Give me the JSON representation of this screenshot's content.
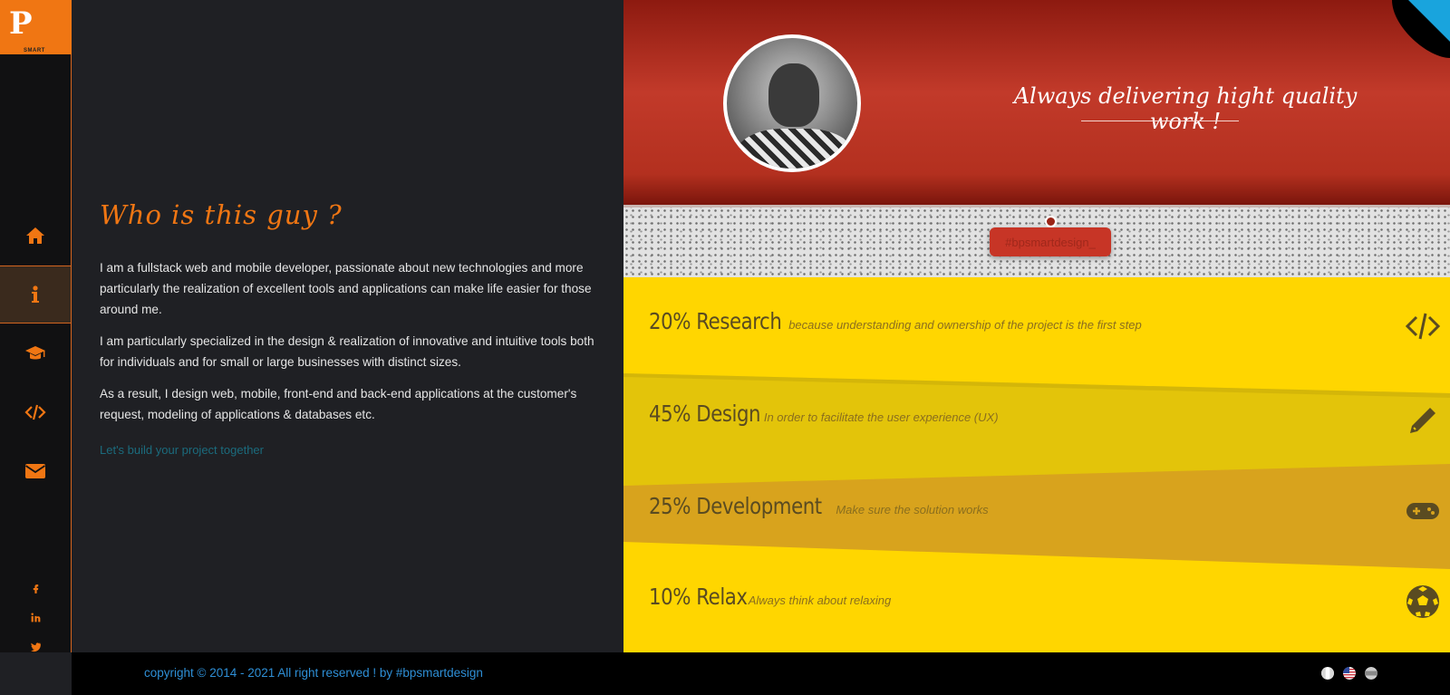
{
  "brand": {
    "logo_text": "P",
    "logo_sub": "SMART"
  },
  "nav": [
    {
      "id": "home",
      "icon": "home-icon",
      "active": false
    },
    {
      "id": "about",
      "icon": "info-icon",
      "active": true
    },
    {
      "id": "education",
      "icon": "graduation-cap-icon",
      "active": false
    },
    {
      "id": "code",
      "icon": "code-icon",
      "active": false
    },
    {
      "id": "contact",
      "icon": "envelope-icon",
      "active": false
    }
  ],
  "social": [
    "facebook-icon",
    "linkedin-icon",
    "twitter-icon",
    "github-icon"
  ],
  "about": {
    "title": "Who is this guy ?",
    "paragraphs": [
      "I am a fullstack web and mobile developer, passionate about new technologies and more particularly the realization of excellent tools and applications can make life easier for those around me.",
      "I am particularly specialized in the design & realization of innovative and intuitive tools both for individuals and for small or large businesses with distinct sizes.",
      "As a result, I design web, mobile, front-end and back-end applications at the customer's request, modeling of applications & databases etc."
    ],
    "cta": "Let's build your project together"
  },
  "hero": {
    "tagline": "Always delivering hight quality work !"
  },
  "hashtag": "#bpsmartdesign_",
  "skills": [
    {
      "title": "20% Research",
      "desc": "because understanding and ownership of the project is the first step",
      "icon": "code-icon"
    },
    {
      "title": "45% Design",
      "desc": "In order to facilitate the user experience (UX)",
      "icon": "pencil-icon"
    },
    {
      "title": "25% Development",
      "desc": "Make sure the solution works",
      "icon": "gamepad-icon"
    },
    {
      "title": "10% Relax",
      "desc": "Always think about relaxing",
      "icon": "soccer-ball-icon"
    }
  ],
  "footer": {
    "copyright": "copyright © 2014 - 2021 All right reserved ! by #bpsmartdesign",
    "languages": [
      "french-flag-icon",
      "us-flag-icon",
      "other-flag-icon"
    ]
  },
  "colors": {
    "accent": "#f07613",
    "hero_red": "#c23a2a",
    "band_yellow": "#ffd600",
    "band_mustard": "#d8a31d",
    "link_blue": "#2e8fd6"
  }
}
